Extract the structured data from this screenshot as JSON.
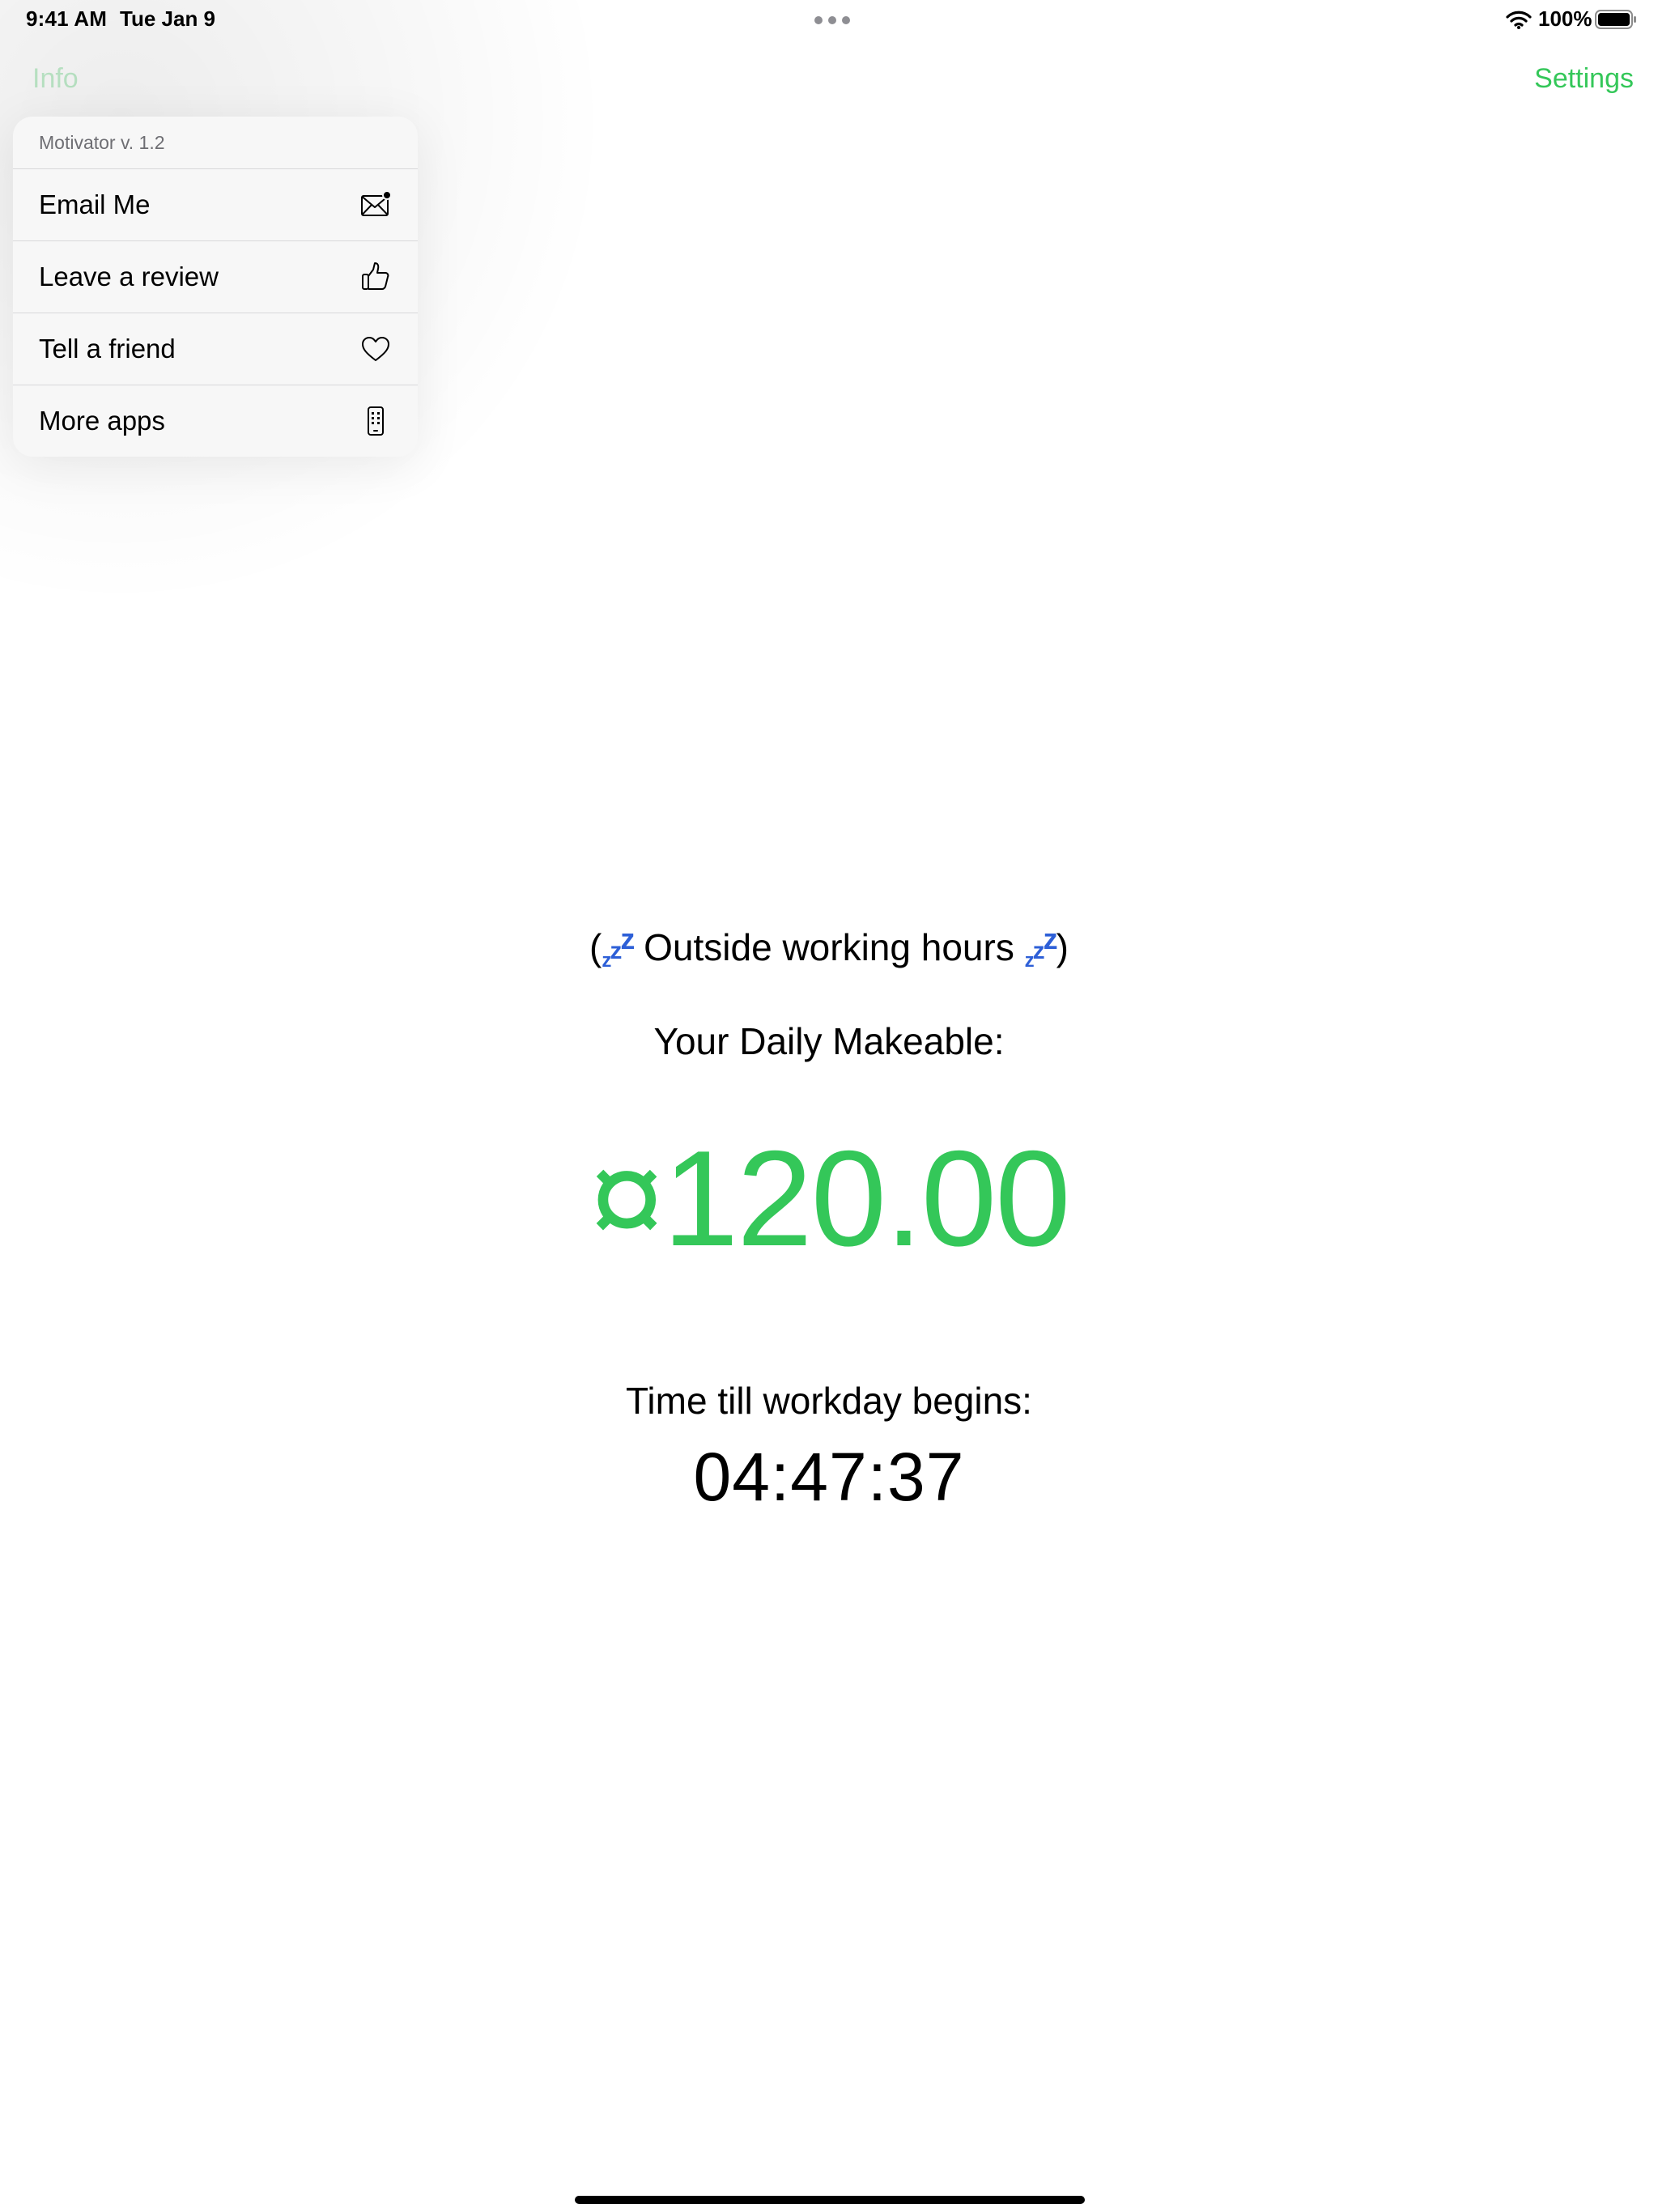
{
  "status_bar": {
    "time": "9:41 AM",
    "date": "Tue Jan 9",
    "battery": "100%"
  },
  "nav": {
    "left_button": "Info",
    "right_button": "Settings"
  },
  "menu": {
    "header": "Motivator v. 1.2",
    "items": [
      {
        "label": "Email Me",
        "icon": "envelope-badge-icon"
      },
      {
        "label": "Leave a review",
        "icon": "thumbs-up-icon"
      },
      {
        "label": "Tell a friend",
        "icon": "heart-icon"
      },
      {
        "label": "More apps",
        "icon": "phone-apps-icon"
      }
    ]
  },
  "main": {
    "status_open": "(",
    "status_text": " Outside working hours ",
    "status_close": ")",
    "daily_label": "Your Daily Makeable:",
    "amount": "¤120.00",
    "countdown_label": "Time till workday begins:",
    "countdown_value": "04:47:37"
  },
  "colors": {
    "accent": "#34c759",
    "sleep_icon": "#2d5fd7"
  }
}
